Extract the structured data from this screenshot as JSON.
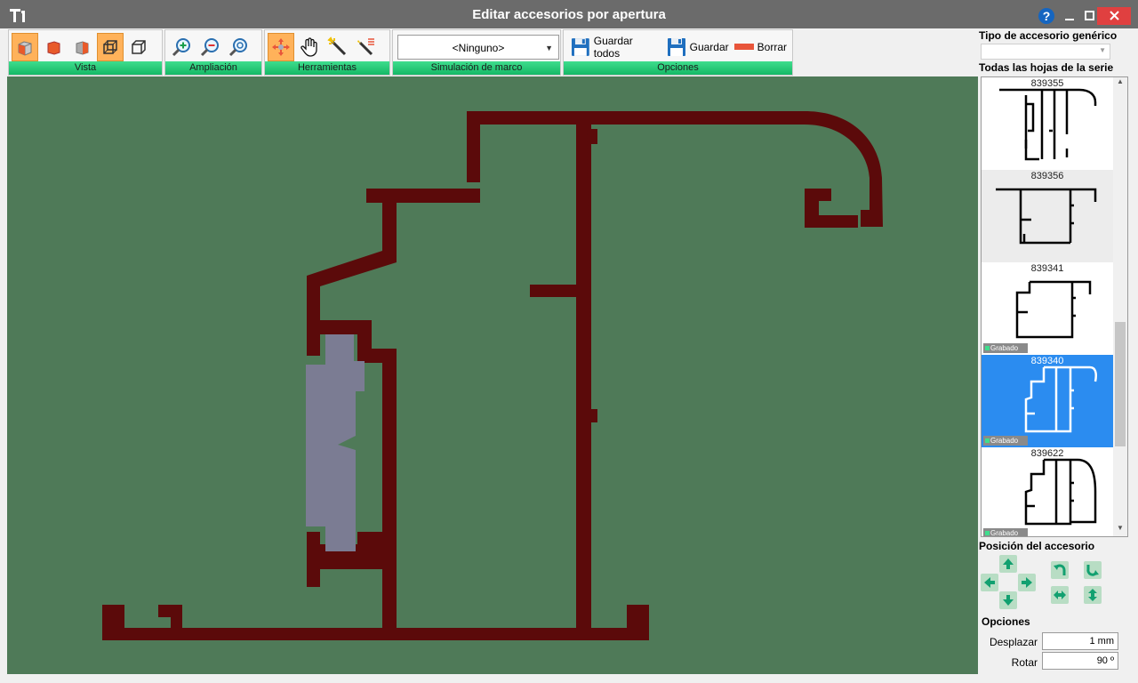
{
  "window": {
    "title": "Editar accesorios por apertura"
  },
  "toolbar": {
    "groups": {
      "vista": "Vista",
      "ampliacion": "Ampliación",
      "herramientas": "Herramientas",
      "simulacion": "Simulación de marco",
      "opciones": "Opciones"
    },
    "frame_sim_selected": "<Ninguno>",
    "save_all_label": "Guardar todos",
    "save_label": "Guardar",
    "delete_label": "Borrar"
  },
  "side": {
    "generic_type_label": "Tipo de accesorio genérico",
    "generic_type_value": "",
    "series_label": "Todas las hojas de la serie",
    "items": [
      {
        "code": "839355",
        "badge": ""
      },
      {
        "code": "839356",
        "badge": ""
      },
      {
        "code": "839341",
        "badge": "Grabado"
      },
      {
        "code": "839340",
        "badge": "Grabado"
      },
      {
        "code": "839622",
        "badge": "Grabado"
      }
    ],
    "position_label": "Posición del accesorio",
    "options_label": "Opciones",
    "desplazar_label": "Desplazar",
    "desplazar_value": "1 mm",
    "rotar_label": "Rotar",
    "rotar_value": "90 º"
  },
  "colors": {
    "canvas_bg": "#4f7a58",
    "profile": "#5b0a0a",
    "accessory": "#7b7c93",
    "selected": "#2b8cf0",
    "group_label": "#1ec776"
  },
  "icons": [
    "app-logo-icon",
    "help-icon",
    "minimize-icon",
    "maximize-icon",
    "close-icon",
    "view-3d-icon",
    "zoom-in-icon",
    "zoom-out-icon",
    "zoom-fit-icon",
    "move-tool-icon",
    "hand-tool-icon",
    "wand-tool-icon",
    "save-all-icon",
    "save-icon",
    "delete-icon",
    "arrow-up-icon",
    "arrow-down-icon",
    "arrow-left-icon",
    "arrow-right-icon",
    "rotate-left-icon",
    "rotate-right-icon",
    "flip-horizontal-icon",
    "flip-vertical-icon"
  ]
}
